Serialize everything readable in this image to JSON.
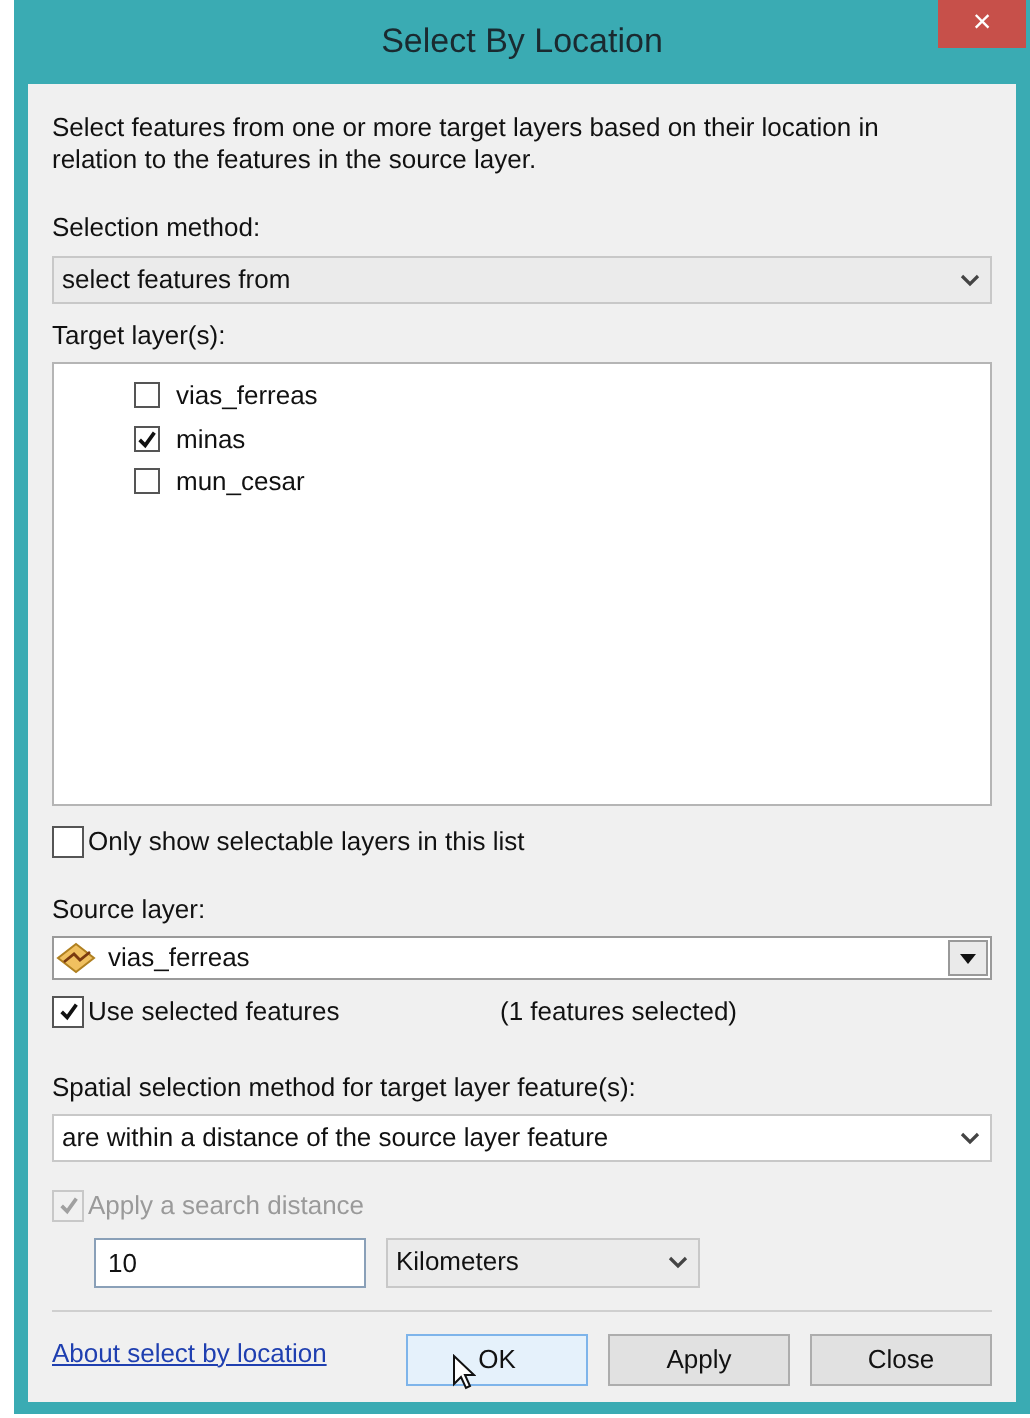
{
  "window": {
    "title": "Select By Location",
    "close": "×"
  },
  "description": "Select features from one or more target layers based on their location in relation to the features in the source layer.",
  "selection_method": {
    "label": "Selection method:",
    "value": "select features from"
  },
  "target_layers": {
    "label": "Target layer(s):",
    "items": [
      {
        "name": "vias_ferreas",
        "checked": false
      },
      {
        "name": "minas",
        "checked": true
      },
      {
        "name": "mun_cesar",
        "checked": false
      }
    ]
  },
  "only_selectable": {
    "label": "Only show selectable layers in this list",
    "checked": false
  },
  "source_layer": {
    "label": "Source layer:",
    "value": "vias_ferreas"
  },
  "use_selected": {
    "label": "Use selected features",
    "checked": true,
    "count": "(1 features selected)"
  },
  "spatial_method": {
    "label": "Spatial selection method for target layer feature(s):",
    "value": "are within a distance of the source layer feature"
  },
  "search_distance": {
    "label": "Apply a search distance",
    "checked": true,
    "disabled": true,
    "value": "10",
    "unit": "Kilometers"
  },
  "help_link": "About select by location",
  "buttons": [
    {
      "label": "OK",
      "hovered": true
    },
    {
      "label": "Apply",
      "hovered": false
    },
    {
      "label": "Close",
      "hovered": false
    }
  ]
}
